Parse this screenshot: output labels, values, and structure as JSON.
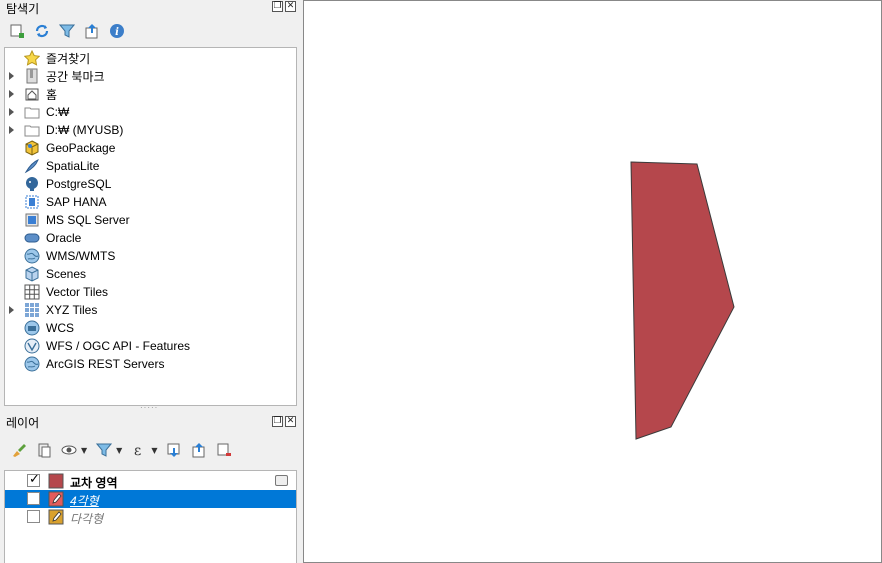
{
  "browser": {
    "title": "탐색기",
    "items": [
      {
        "label": "즐겨찾기",
        "icon": "star-icon",
        "expandable": false
      },
      {
        "label": "공간 북마크",
        "icon": "bookmark-icon",
        "expandable": true
      },
      {
        "label": "홈",
        "icon": "home-icon",
        "expandable": true
      },
      {
        "label": "C:₩",
        "icon": "folder-icon",
        "expandable": true
      },
      {
        "label": "D:₩ (MYUSB)",
        "icon": "folder-icon",
        "expandable": true
      },
      {
        "label": "GeoPackage",
        "icon": "geopackage-icon",
        "expandable": false
      },
      {
        "label": "SpatiaLite",
        "icon": "spatialite-icon",
        "expandable": false
      },
      {
        "label": "PostgreSQL",
        "icon": "postgresql-icon",
        "expandable": false
      },
      {
        "label": "SAP HANA",
        "icon": "sap-hana-icon",
        "expandable": false
      },
      {
        "label": "MS SQL Server",
        "icon": "mssql-icon",
        "expandable": false
      },
      {
        "label": "Oracle",
        "icon": "oracle-icon",
        "expandable": false
      },
      {
        "label": "WMS/WMTS",
        "icon": "wms-icon",
        "expandable": false
      },
      {
        "label": "Scenes",
        "icon": "scenes-icon",
        "expandable": false
      },
      {
        "label": "Vector Tiles",
        "icon": "vector-tiles-icon",
        "expandable": false
      },
      {
        "label": "XYZ Tiles",
        "icon": "xyz-tiles-icon",
        "expandable": true
      },
      {
        "label": "WCS",
        "icon": "wcs-icon",
        "expandable": false
      },
      {
        "label": "WFS / OGC API - Features",
        "icon": "wfs-icon",
        "expandable": false
      },
      {
        "label": "ArcGIS REST Servers",
        "icon": "arcgis-icon",
        "expandable": false
      }
    ]
  },
  "layers_panel": {
    "title": "레이어",
    "layers": [
      {
        "name": "교차 영역",
        "checked": true,
        "selected": false,
        "style": "bold",
        "color": "#b5474c"
      },
      {
        "name": "4각형",
        "checked": false,
        "selected": true,
        "style": "italic",
        "color": "#e25b5b"
      },
      {
        "name": "다각형",
        "checked": false,
        "selected": false,
        "style": "italic",
        "color": "#d9a12e"
      }
    ]
  },
  "map": {
    "polygon_fill": "#b5474c",
    "polygon_stroke": "#3a3a3a"
  }
}
